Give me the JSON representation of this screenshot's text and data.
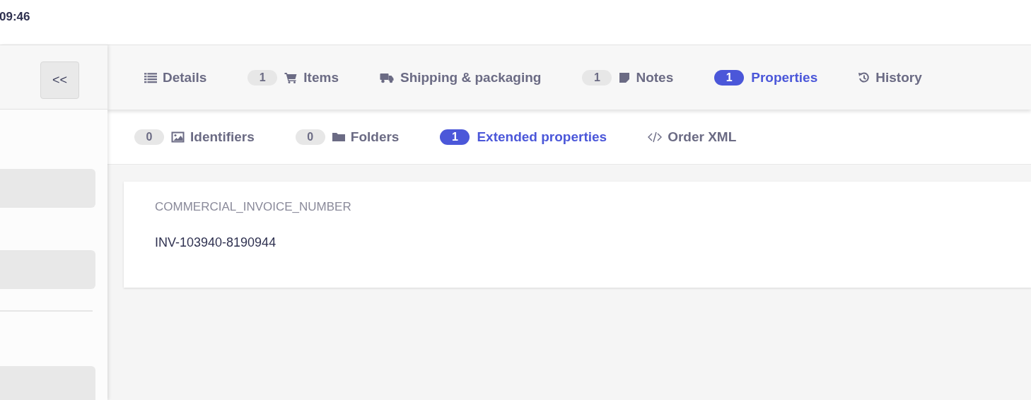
{
  "header": {
    "time": "09:46"
  },
  "sidebar": {
    "collapse_button": "<<"
  },
  "tabs": [
    {
      "label": "Details",
      "selected": false
    },
    {
      "label": "Items",
      "count": "1",
      "selected": false
    },
    {
      "label": "Shipping & packaging",
      "selected": false
    },
    {
      "label": "Notes",
      "count": "1",
      "selected": false
    },
    {
      "label": "Properties",
      "count": "1",
      "selected": true
    },
    {
      "label": "History",
      "selected": false
    }
  ],
  "subtabs": [
    {
      "label": "Identifiers",
      "count": "0",
      "selected": false
    },
    {
      "label": "Folders",
      "count": "0",
      "selected": false
    },
    {
      "label": "Extended properties",
      "count": "1",
      "selected": true
    },
    {
      "label": "Order XML",
      "selected": false
    }
  ],
  "properties": [
    {
      "name": "COMMERCIAL_INVOICE_NUMBER",
      "value": "INV-103940-8190944"
    }
  ]
}
